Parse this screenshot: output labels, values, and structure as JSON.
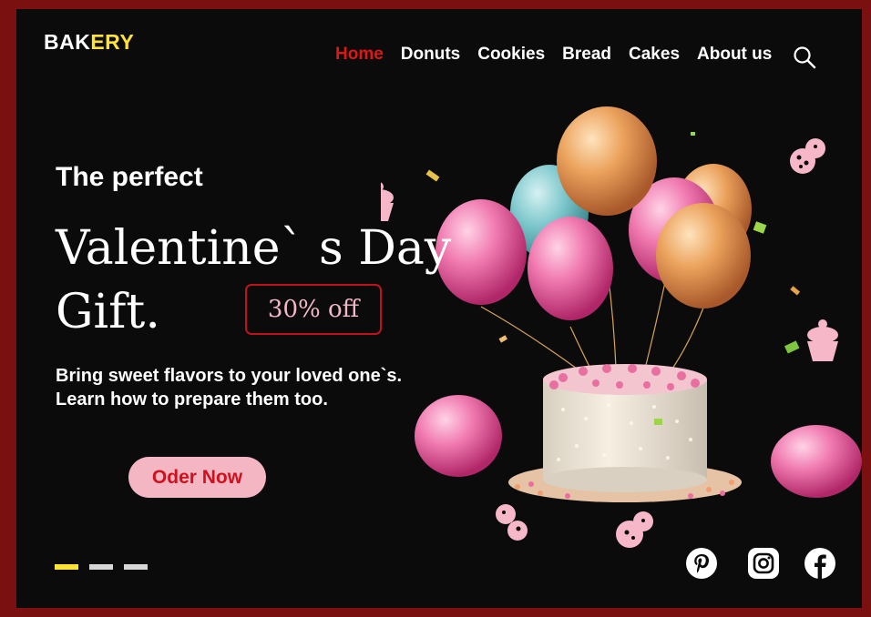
{
  "logo": {
    "part1": "BAK",
    "part2": "ERY"
  },
  "nav": {
    "items": [
      {
        "label": "Home",
        "active": true
      },
      {
        "label": "Donuts",
        "active": false
      },
      {
        "label": "Cookies",
        "active": false
      },
      {
        "label": "Bread",
        "active": false
      },
      {
        "label": "Cakes",
        "active": false
      },
      {
        "label": "About us",
        "active": false
      }
    ],
    "search_icon": "search-icon"
  },
  "hero": {
    "kicker": "The perfect",
    "headline_line1": "Valentine` s Day",
    "headline_line2": "Gift.",
    "discount": "30% off",
    "description_line1": "Bring sweet flavors to your loved one`s.",
    "description_line2": "Learn how to prepare them too.",
    "cta": "Oder Now"
  },
  "slider": {
    "count": 3,
    "active_index": 0
  },
  "social": [
    "pinterest-icon",
    "instagram-icon",
    "facebook-icon"
  ],
  "colors": {
    "frame": "#7a1010",
    "background": "#0b0b0b",
    "accent_red": "#e01616",
    "accent_yellow": "#ffe234",
    "pink": "#f5b6c4"
  }
}
